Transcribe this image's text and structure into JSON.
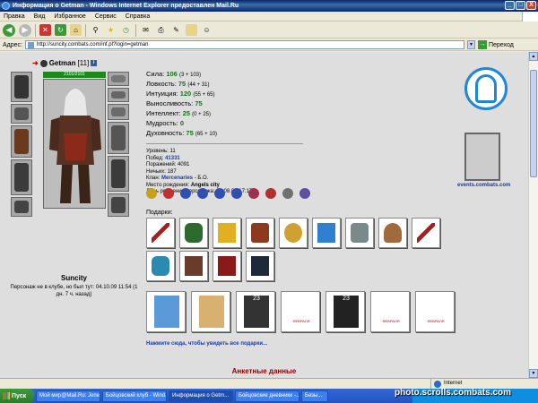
{
  "window": {
    "title": "Информация о Getman - Windows Internet Explorer предоставлен Mail.Ru",
    "controls": [
      "_",
      "□",
      "X"
    ]
  },
  "menu": [
    "Правка",
    "Вид",
    "Избранное",
    "Сервис",
    "Справка"
  ],
  "address": {
    "label": "Адрес:",
    "url": "http://suncity.combats.com/inf.pl?login=getman",
    "go_label": "Переход"
  },
  "character": {
    "nick": "Getman",
    "level": "[11]",
    "hp": "2101/2101",
    "avatar_name": "Suncity",
    "note": "Персонаж не в клубе, но был тут: 04.10.09 11:54 (1 дн. 7 ч. назад)"
  },
  "stats": [
    {
      "label": "Сила:",
      "value": "106",
      "bonus": "(3 + 103)"
    },
    {
      "label": "Ловкость:",
      "value": "75",
      "bonus": "(44 + 31)"
    },
    {
      "label": "Интуиция:",
      "value": "120",
      "bonus": "(55 + 65)"
    },
    {
      "label": "Выносливость:",
      "value": "75",
      "bonus": ""
    },
    {
      "label": "Интеллект:",
      "value": "25",
      "bonus": "(0 + 25)"
    },
    {
      "label": "Мудрость:",
      "value": "0",
      "bonus": ""
    },
    {
      "label": "Духовность:",
      "value": "75",
      "bonus": "(65 + 10)"
    }
  ],
  "info": {
    "level_label": "Уровень:",
    "level": "11",
    "wins_label": "Побед:",
    "wins": "41331",
    "losses_label": "Поражений:",
    "losses": "4091",
    "draws_label": "Ничьих:",
    "draws": "187",
    "clan_label": "Клан:",
    "clan": "Mercenaries",
    "clan_rank": "- Б.О.",
    "birthplace_label": "Место рождения:",
    "birthplace": "Angels city",
    "birthday_label": "День рождения персонажа:",
    "birthday": "21.08.02 17:17"
  },
  "gifts_label": "Подарки:",
  "gifts_link": "Нажмите сюда, чтобы увидеть все подарки...",
  "cards": [
    {
      "caption": ""
    },
    {
      "caption": ""
    },
    {
      "caption": "23"
    },
    {
      "caption": "ФЕВРАЛЯ"
    },
    {
      "caption": "23"
    },
    {
      "caption": "ФЕВРАЛЯ"
    },
    {
      "caption": "ФЕВРАЛЯ"
    }
  ],
  "profile_title": "Анкетные данные",
  "clan_site": "events.combats.com",
  "status": {
    "zone": "Internet"
  },
  "taskbar": {
    "start": "Пуск",
    "tasks": [
      "Мой мир@Mail.Ru: Jene...",
      "Бойцовский клуб - Wind...",
      "Информация о Getm...",
      "Бойцовские дневники -...",
      "Безы..."
    ],
    "watermark": "photo.scrolls.combats.com"
  },
  "colors": {
    "stat_value": "#1d6f1d",
    "link": "#1b3c9a",
    "title": "#8b0000",
    "hp": "#1d8a1d"
  }
}
